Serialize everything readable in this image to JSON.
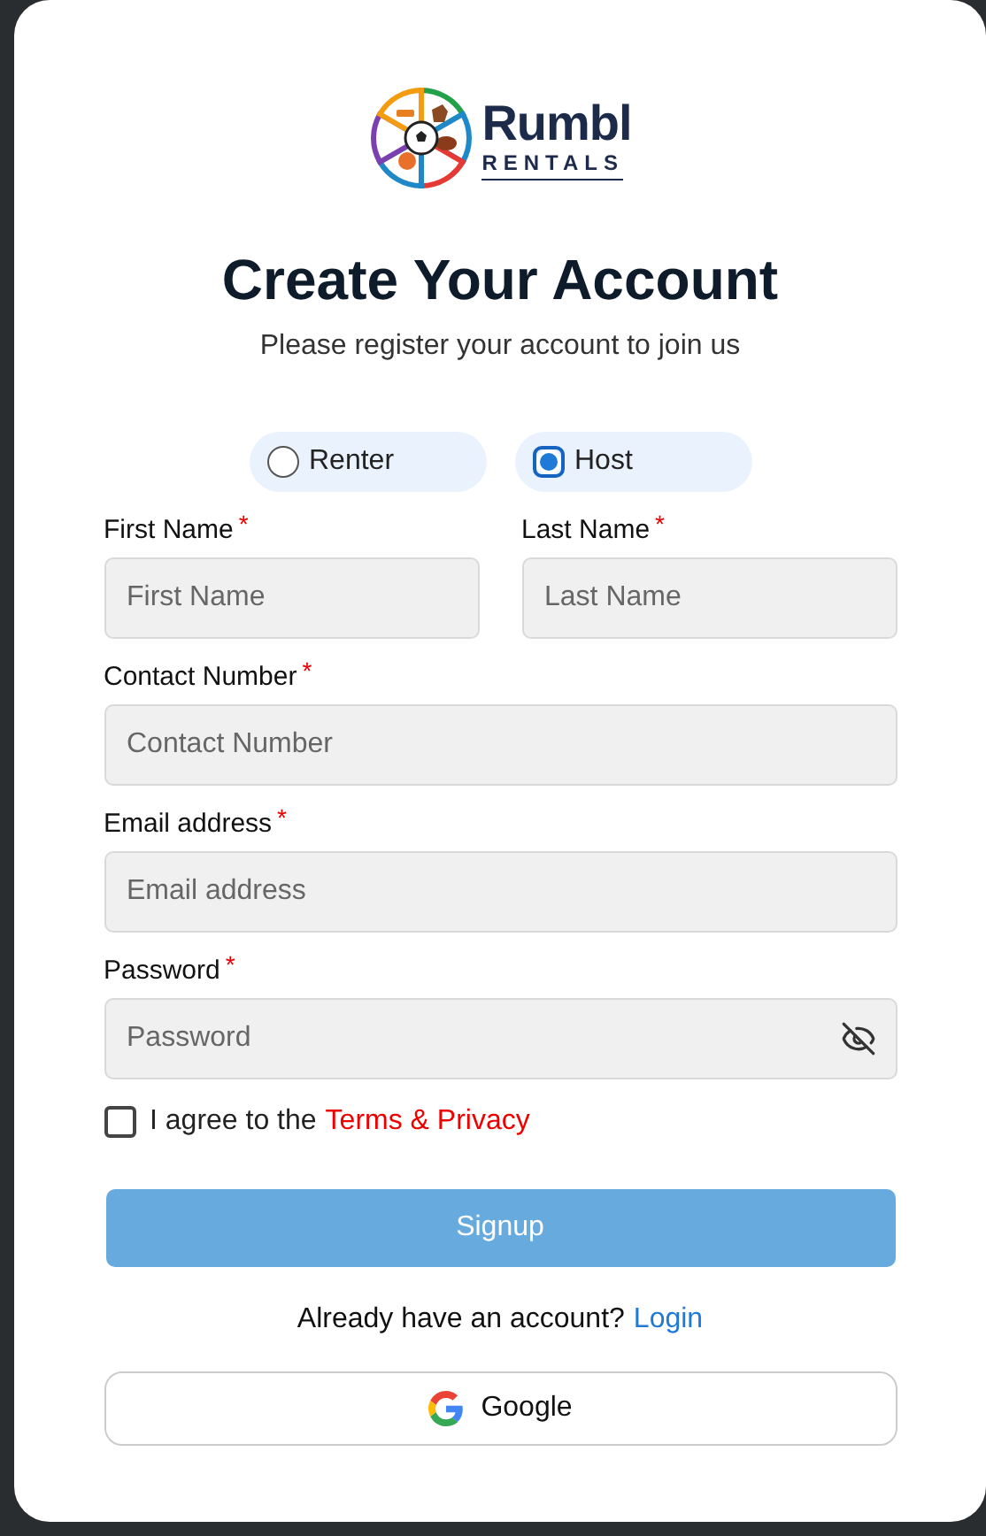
{
  "logo": {
    "name": "Rumbl",
    "tagline": "RENTALS"
  },
  "title": "Create Your Account",
  "subtitle": "Please register your account to join us",
  "roles": [
    {
      "label": "Renter",
      "selected": false
    },
    {
      "label": "Host",
      "selected": true
    }
  ],
  "fields": [
    {
      "label": "First Name",
      "required_mark": "*",
      "placeholder": "First Name",
      "kind": "text"
    },
    {
      "label": "Last Name",
      "required_mark": "*",
      "placeholder": "Last Name",
      "kind": "text"
    },
    {
      "label": "Contact Number",
      "required_mark": "*",
      "placeholder": "Contact Number",
      "kind": "text"
    },
    {
      "label": "Email address",
      "required_mark": "*",
      "placeholder": "Email address",
      "kind": "text"
    },
    {
      "label": "Password",
      "required_mark": "*",
      "placeholder": "Password",
      "kind": "password"
    }
  ],
  "agree": {
    "checked": false,
    "text": "I agree to the",
    "link": "Terms & Privacy"
  },
  "signup": "Signup",
  "login_prompt": {
    "text": "Already have an account?",
    "link": "Login"
  },
  "google": "Google"
}
